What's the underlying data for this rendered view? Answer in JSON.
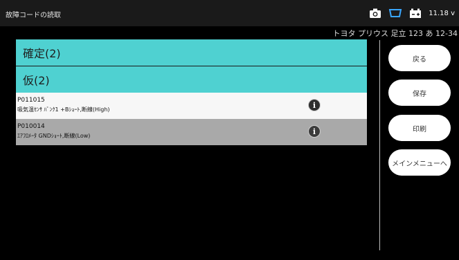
{
  "header": {
    "title": "故障コードの読取",
    "voltage": "11.18 v"
  },
  "vehicle_info": "トヨタ プリウス 足立 123 あ 12-34",
  "sections": {
    "confirmed": "確定(2)",
    "pending": "仮(2)"
  },
  "codes": [
    {
      "code": "P011015",
      "description": "吸気温ｾﾝｻ ﾊﾞﾝｸ1 +Bｼｮｰﾄ,断線(High)"
    },
    {
      "code": "P010014",
      "description": "ｴｱﾌﾛﾒｰﾀ GNDｼｮｰﾄ,断線(Low)"
    }
  ],
  "buttons": {
    "back": "戻る",
    "save": "保存",
    "print": "印刷",
    "main_menu": "メインメニューへ"
  },
  "icons": {
    "camera": "camera-icon",
    "connection": "obd-connection-icon",
    "battery": "battery-icon",
    "info": "info-icon"
  }
}
